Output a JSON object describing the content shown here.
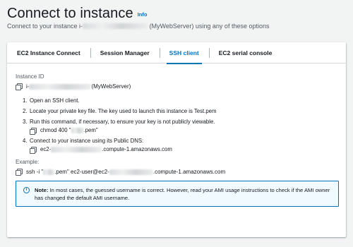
{
  "header": {
    "title": "Connect to instance",
    "info_link": "Info",
    "subtitle_prefix": "Connect to your instance i-",
    "subtitle_suffix": " (MyWebServer) using any of these options"
  },
  "tabs": [
    {
      "label": "EC2 Instance Connect"
    },
    {
      "label": "Session Manager"
    },
    {
      "label": "SSH client"
    },
    {
      "label": "EC2 serial console"
    }
  ],
  "active_tab": "SSH client",
  "ssh": {
    "instance_id_label": "Instance ID",
    "instance_id_prefix": "i-",
    "instance_id_suffix": "(MyWebServer)",
    "steps": [
      {
        "num": "1.",
        "text": "Open an SSH client."
      },
      {
        "num": "2.",
        "text": "Locate your private key file. The key used to launch this instance is Test.pem"
      },
      {
        "num": "3.",
        "text": "Run this command, if necessary, to ensure your key is not publicly viewable."
      },
      {
        "num": "4.",
        "text": "Connect to your instance using its Public DNS:"
      }
    ],
    "chmod_prefix": "chmod 400 \"",
    "chmod_suffix": ".pem\"",
    "dns_prefix": "ec2-",
    "dns_suffix": ".compute-1.amazonaws.com",
    "example_label": "Example:",
    "example_prefix": "ssh -i \"",
    "example_middle": ".pem\" ec2-user@ec2-",
    "example_suffix": ".compute-1.amazonaws.com"
  },
  "note": {
    "bold": "Note:",
    "text": " In most cases, the guessed username is correct. However, read your AMI usage instructions to check if the AMI owner has changed the default AMI username."
  },
  "colors": {
    "accent": "#0073bb",
    "note_bg": "#f1faff",
    "page_bg": "#f2f3f3"
  },
  "icons": [
    "copy-icon",
    "info-icon"
  ]
}
